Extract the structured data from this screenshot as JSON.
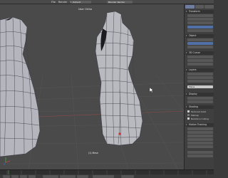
{
  "header": {
    "menu": [
      "File",
      "Render",
      "Window",
      "Help"
    ],
    "screen_field": "Default",
    "engine_field": "Blender Render"
  },
  "viewport": {
    "view_label": "User Ortho",
    "object_label": "(1) Mesh"
  },
  "properties": {
    "panels": [
      "Transform",
      "Object",
      "3D Cursor",
      "Layers",
      "Display",
      "Shading",
      "Motion Tracking"
    ],
    "shading_options": [
      "Textured Solid",
      "Matcap",
      "Backface Culling"
    ],
    "layer_field": "Plane"
  },
  "colors": {
    "viewport_bg": "#4a4a4a",
    "mesh_fill": "#b9b9c0",
    "grid": "#555555",
    "selected_accent": "#5270a8"
  }
}
